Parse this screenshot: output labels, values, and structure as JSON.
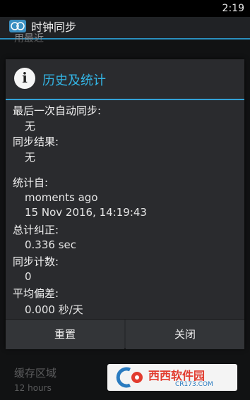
{
  "status_bar": {
    "time": "2:19"
  },
  "app_bar": {
    "title": "时钟同步"
  },
  "background_items": [
    {
      "text": "用最近"
    },
    {
      "text": "缓存区域"
    },
    {
      "text": "12 hours"
    }
  ],
  "dialog": {
    "title": "历史及统计",
    "fields": [
      {
        "label": "最后一次自动同步:",
        "value": "无"
      },
      {
        "label": "同步结果:",
        "value": "无"
      },
      {
        "label": "统计自:",
        "value": "moments ago",
        "value2": "15 Nov 2016, 14:19:43"
      },
      {
        "label": "总计纠正:",
        "value": "0.336 sec"
      },
      {
        "label": "同步计数:",
        "value": "0"
      },
      {
        "label": "平均偏差:",
        "value": "0.000 秒/天"
      }
    ],
    "buttons": {
      "reset": "重置",
      "close": "关闭"
    }
  },
  "watermark": {
    "brand": "西西软件园",
    "url": "CR173.COM"
  },
  "colors": {
    "accent": "#33b5e5",
    "dialog_bg": "#2a2b2e",
    "app_bg": "#1e1f21"
  }
}
